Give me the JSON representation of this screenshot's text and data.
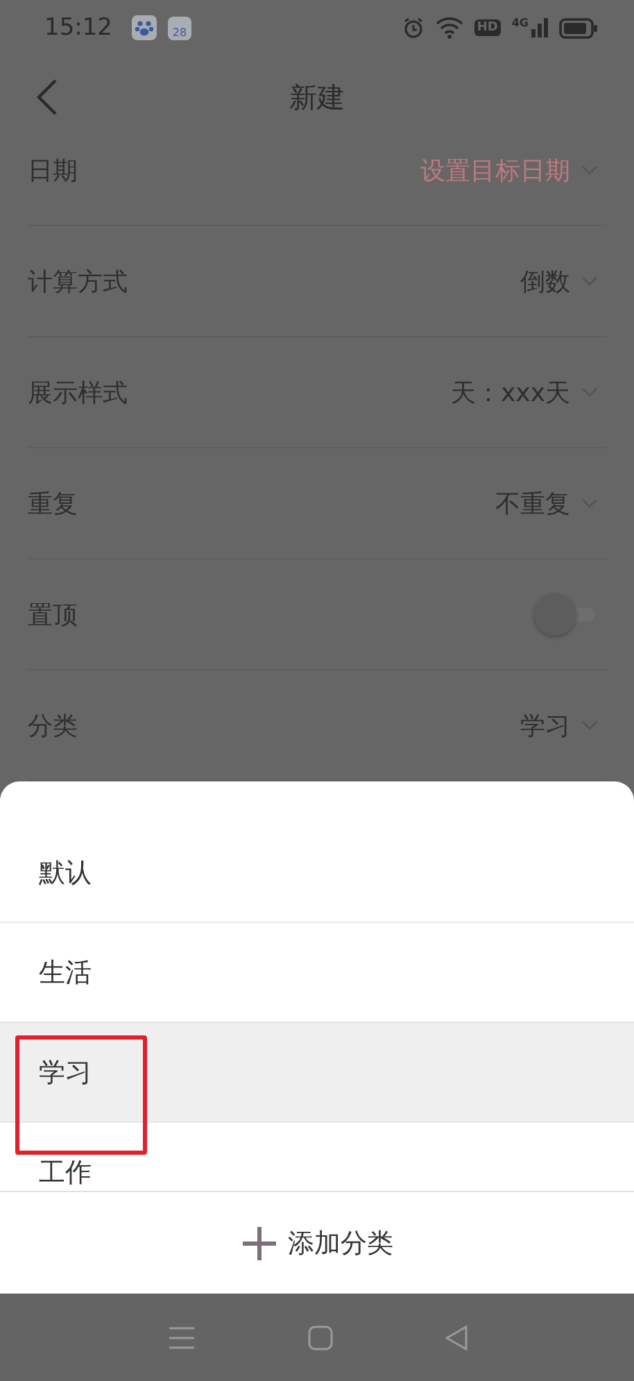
{
  "status_bar": {
    "time": "15:12",
    "calendar_day": "28",
    "hd_label": "HD",
    "network_label": "4G"
  },
  "header": {
    "title": "新建"
  },
  "rows": [
    {
      "label": "日期",
      "kind": "select",
      "value": "设置目标日期",
      "accent": true
    },
    {
      "label": "计算方式",
      "kind": "select",
      "value": "倒数",
      "accent": false
    },
    {
      "label": "展示样式",
      "kind": "select",
      "value": "天：xxx天",
      "accent": false
    },
    {
      "label": "重复",
      "kind": "select",
      "value": "不重复",
      "accent": false
    },
    {
      "label": "置顶",
      "kind": "toggle",
      "on": false
    },
    {
      "label": "分类",
      "kind": "select",
      "value": "学习",
      "accent": false
    }
  ],
  "sheet": {
    "items": [
      {
        "label": "默认",
        "selected": false,
        "highlighted": false
      },
      {
        "label": "生活",
        "selected": false,
        "highlighted": false
      },
      {
        "label": "学习",
        "selected": true,
        "highlighted": true
      },
      {
        "label": "工作",
        "selected": false,
        "highlighted": false
      }
    ],
    "add_button": "添加分类"
  }
}
